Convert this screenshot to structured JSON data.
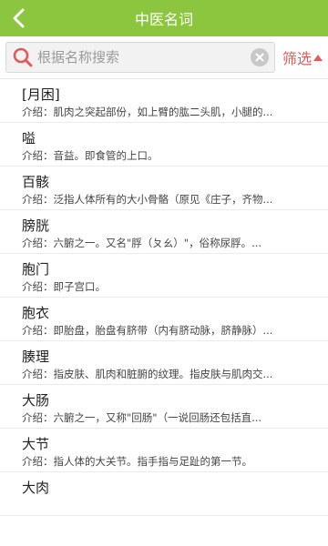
{
  "header": {
    "title": "中医名词"
  },
  "search": {
    "placeholder": "根据名称搜索",
    "value": ""
  },
  "filter": {
    "label": "筛选"
  },
  "items": [
    {
      "term": "[月困]",
      "desc": "介绍：肌肉之突起部份，如上臂的肱二头肌，小腿的..."
    },
    {
      "term": "嗌",
      "desc": "介绍：音益。即食管的上口。"
    },
    {
      "term": "百骸",
      "desc": "介绍：泛指人体所有的大小骨骼（原见《庄子，齐物..."
    },
    {
      "term": "膀胱",
      "desc": "介绍：六腑之一。又名\"脬（ㄆㄠ）\"，俗称尿脬。..."
    },
    {
      "term": "胞门",
      "desc": "介绍：即子宫口。"
    },
    {
      "term": "胞衣",
      "desc": "介绍：即胎盘，胎盘有脐带（内有脐动脉，脐静脉）..."
    },
    {
      "term": "腠理",
      "desc": "介绍：指皮肤、肌肉和脏腑的纹理。指皮肤与肌肉交..."
    },
    {
      "term": "大肠",
      "desc": "介绍：六腑之一，又称\"回肠\"（一说回肠还包括直..."
    },
    {
      "term": "大节",
      "desc": "介绍：指人体的大关节。指手指与足趾的第一节。"
    },
    {
      "term": "大肉",
      "desc": ""
    }
  ]
}
